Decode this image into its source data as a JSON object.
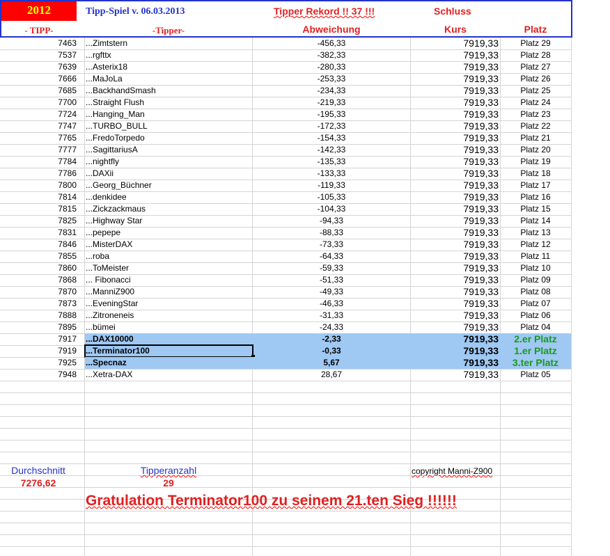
{
  "header": {
    "year": "2012",
    "title": "Tipp-Spiel v. 06.03.2013",
    "record": "Tipper Rekord !!  37  !!!",
    "schluss": "Schluss",
    "col_tipp": "- TIPP-",
    "col_tipper": "-Tipper-",
    "col_abweichung": "Abweichung",
    "col_kurs": "Kurs",
    "col_platz": "Platz"
  },
  "rows": [
    {
      "tipp": "7463",
      "tipper": "...Zimtstern",
      "abw": "-456,33",
      "kurs": "7919,33",
      "platz": "Platz 29"
    },
    {
      "tipp": "7537",
      "tipper": "...rgfttx",
      "abw": "-382,33",
      "kurs": "7919,33",
      "platz": "Platz 28"
    },
    {
      "tipp": "7639",
      "tipper": "...Asterix18",
      "abw": "-280,33",
      "kurs": "7919,33",
      "platz": "Platz 27"
    },
    {
      "tipp": "7666",
      "tipper": "...MaJoLa",
      "abw": "-253,33",
      "kurs": "7919,33",
      "platz": "Platz 26"
    },
    {
      "tipp": "7685",
      "tipper": "...BackhandSmash",
      "abw": "-234,33",
      "kurs": "7919,33",
      "platz": "Platz 25"
    },
    {
      "tipp": "7700",
      "tipper": "...Straight Flush",
      "abw": "-219,33",
      "kurs": "7919,33",
      "platz": "Platz 24"
    },
    {
      "tipp": "7724",
      "tipper": "...Hanging_Man",
      "abw": "-195,33",
      "kurs": "7919,33",
      "platz": "Platz 23"
    },
    {
      "tipp": "7747",
      "tipper": "...TURBO_BULL",
      "abw": "-172,33",
      "kurs": "7919,33",
      "platz": "Platz 22"
    },
    {
      "tipp": "7765",
      "tipper": "...FredoTorpedo",
      "abw": "-154,33",
      "kurs": "7919,33",
      "platz": "Platz 21"
    },
    {
      "tipp": "7777",
      "tipper": "...SagittariusA",
      "abw": "-142,33",
      "kurs": "7919,33",
      "platz": "Platz 20"
    },
    {
      "tipp": "7784",
      "tipper": "...nightfly",
      "abw": "-135,33",
      "kurs": "7919,33",
      "platz": "Platz 19"
    },
    {
      "tipp": "7786",
      "tipper": "...DAXii",
      "abw": "-133,33",
      "kurs": "7919,33",
      "platz": "Platz 18"
    },
    {
      "tipp": "7800",
      "tipper": "...Georg_Büchner",
      "abw": "-119,33",
      "kurs": "7919,33",
      "platz": "Platz 17"
    },
    {
      "tipp": "7814",
      "tipper": "...denkidee",
      "abw": "-105,33",
      "kurs": "7919,33",
      "platz": "Platz 16"
    },
    {
      "tipp": "7815",
      "tipper": "...Zickzackmaus",
      "abw": "-104,33",
      "kurs": "7919,33",
      "platz": "Platz 15"
    },
    {
      "tipp": "7825",
      "tipper": "...Highway Star",
      "abw": "-94,33",
      "kurs": "7919,33",
      "platz": "Platz 14"
    },
    {
      "tipp": "7831",
      "tipper": "...pepepe",
      "abw": "-88,33",
      "kurs": "7919,33",
      "platz": "Platz 13"
    },
    {
      "tipp": "7846",
      "tipper": "...MisterDAX",
      "abw": "-73,33",
      "kurs": "7919,33",
      "platz": "Platz 12"
    },
    {
      "tipp": "7855",
      "tipper": "...roba",
      "abw": "-64,33",
      "kurs": "7919,33",
      "platz": "Platz 11"
    },
    {
      "tipp": "7860",
      "tipper": "...ToMeister",
      "abw": "-59,33",
      "kurs": "7919,33",
      "platz": "Platz 10"
    },
    {
      "tipp": "7868",
      "tipper": "... Fibonacci",
      "abw": "-51,33",
      "kurs": "7919,33",
      "platz": "Platz 09"
    },
    {
      "tipp": "7870",
      "tipper": "...ManniZ900",
      "abw": "-49,33",
      "kurs": "7919,33",
      "platz": "Platz 08"
    },
    {
      "tipp": "7873",
      "tipper": "...EveningStar",
      "abw": "-46,33",
      "kurs": "7919,33",
      "platz": "Platz 07"
    },
    {
      "tipp": "7888",
      "tipper": "...Zitroneneis",
      "abw": "-31,33",
      "kurs": "7919,33",
      "platz": "Platz 06"
    },
    {
      "tipp": "7895",
      "tipper": "...bümei",
      "abw": "-24,33",
      "kurs": "7919,33",
      "platz": "Platz 04"
    },
    {
      "tipp": "7917",
      "tipper": "...DAX10000",
      "abw": "-2,33",
      "kurs": "7919,33",
      "platz": "2.er Platz",
      "highlight": true
    },
    {
      "tipp": "7919",
      "tipper": "...Terminator100",
      "abw": "-0,33",
      "kurs": "7919,33",
      "platz": "1.er Platz",
      "highlight": true,
      "selected": true
    },
    {
      "tipp": "7925",
      "tipper": "...Specnaz",
      "abw": "5,67",
      "kurs": "7919,33",
      "platz": "3.ter Platz",
      "highlight": true
    },
    {
      "tipp": "7948",
      "tipper": "...Xetra-DAX",
      "abw": "28,67",
      "kurs": "7919,33",
      "platz": "Platz 05"
    }
  ],
  "footer": {
    "durchschnitt_label": "Durchschnitt",
    "durchschnitt_value": "7276,62",
    "tipperanzahl_label": "Tipperanzahl",
    "tipperanzahl_value": "29",
    "copyright": "copyright Manni-Z900",
    "gratulation": "Gratulation Terminator100  zu seinem 21.ten Sieg !!!!!!"
  },
  "colors": {
    "header_blue": "#2233cc",
    "year_bg": "#ff0000",
    "year_text": "#ffff00",
    "red_text": "#e02020",
    "highlight_bg": "#9fc8f3",
    "podium_green": "#1a9a1a",
    "gridline": "#d4d4d4"
  }
}
